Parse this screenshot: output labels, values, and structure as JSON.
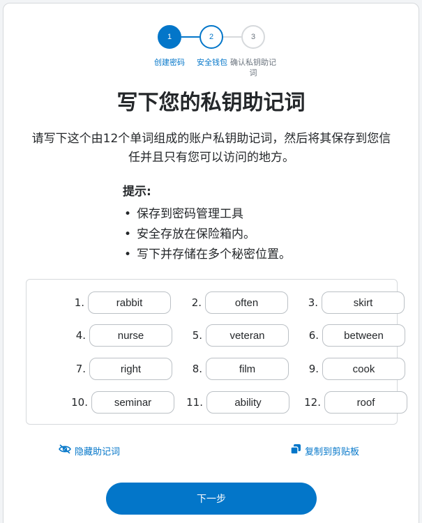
{
  "stepper": {
    "steps": [
      {
        "number": "1",
        "label": "创建密码"
      },
      {
        "number": "2",
        "label": "安全钱包"
      },
      {
        "number": "3",
        "label": "确认私钥助记词"
      }
    ]
  },
  "page_title": "写下您的私钥助记词",
  "description": "请写下这个由12个单词组成的账户私钥助记词，然后将其保存到您信任并且只有您可以访问的地方。",
  "tips": {
    "title": "提示:",
    "items": [
      "保存到密码管理工具",
      "安全存放在保险箱内。",
      "写下并存储在多个秘密位置。"
    ]
  },
  "phrase": {
    "words": [
      {
        "num": "1.",
        "word": "rabbit"
      },
      {
        "num": "2.",
        "word": "often"
      },
      {
        "num": "3.",
        "word": "skirt"
      },
      {
        "num": "4.",
        "word": "nurse"
      },
      {
        "num": "5.",
        "word": "veteran"
      },
      {
        "num": "6.",
        "word": "between"
      },
      {
        "num": "7.",
        "word": "right"
      },
      {
        "num": "8.",
        "word": "film"
      },
      {
        "num": "9.",
        "word": "cook"
      },
      {
        "num": "10.",
        "word": "seminar"
      },
      {
        "num": "11.",
        "word": "ability"
      },
      {
        "num": "12.",
        "word": "roof"
      }
    ]
  },
  "actions": {
    "hide_label": "隐藏助记词",
    "hide_icon": "eye-slash-icon",
    "copy_label": "复制到剪贴板",
    "copy_icon": "copy-icon"
  },
  "next_button_label": "下一步",
  "colors": {
    "accent": "#0376c9",
    "border": "#d6d9dc",
    "text": "#24272a",
    "muted": "#6a737d"
  }
}
